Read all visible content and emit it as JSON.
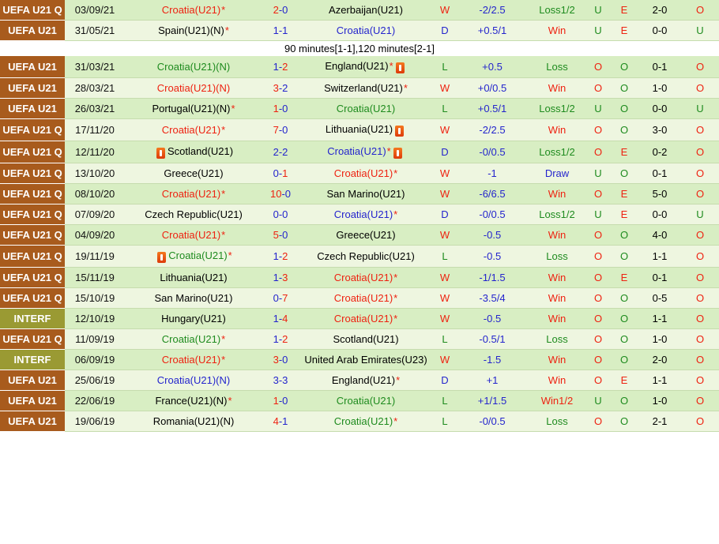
{
  "palette": {
    "win_red": "#ee2211",
    "draw_blue": "#2424cd",
    "loss_green": "#1e8b1e",
    "uefa_cell_brown": "#a85b1d",
    "interf_cell_olive": "#9a9a33",
    "row_green": "#d8eec3",
    "row_light": "#eef6e0",
    "red_card_orange": "#dd3a0a"
  },
  "icons": {
    "red_card": "red-card-with-white-bar"
  },
  "table": {
    "column_semantics": [
      "competition",
      "date",
      "home_team",
      "score",
      "away_team",
      "result_letter",
      "handicap",
      "handicap_result",
      "over_under",
      "even_odd",
      "second_score",
      "second_over_under"
    ],
    "rows": [
      {
        "competition": "UEFA U21 Q",
        "date": "03/09/21",
        "home": {
          "name": "Croatia(U21)",
          "star": true,
          "color": "red"
        },
        "score": {
          "home": "2",
          "away": "0",
          "winner": "home"
        },
        "away": {
          "name": "Azerbaijan(U21)"
        },
        "result": "W",
        "handicap": "-2/2.5",
        "handicap_result": "Loss1/2",
        "over_under": "U",
        "even_odd": "E",
        "second_score": "2-0",
        "second_over_under": "O"
      },
      {
        "competition": "UEFA U21",
        "date": "31/05/21",
        "home": {
          "name": "Spain(U21)(N)",
          "star": true
        },
        "score": {
          "home": "1",
          "away": "1",
          "winner": "none"
        },
        "away": {
          "name": "Croatia(U21)",
          "color": "blue"
        },
        "result": "D",
        "handicap": "+0.5/1",
        "handicap_result": "Win",
        "over_under": "U",
        "even_odd": "E",
        "second_score": "0-0",
        "second_over_under": "U"
      },
      {
        "type": "note",
        "text": "90 minutes[1-1],120 minutes[2-1]"
      },
      {
        "competition": "UEFA U21",
        "date": "31/03/21",
        "home": {
          "name": "Croatia(U21)(N)",
          "color": "green"
        },
        "score": {
          "home": "1",
          "away": "2",
          "winner": "away"
        },
        "away": {
          "name": "England(U21)",
          "star": true,
          "card_after": true
        },
        "result": "L",
        "handicap": "+0.5",
        "handicap_result": "Loss",
        "over_under": "O",
        "even_odd": "O",
        "second_score": "0-1",
        "second_over_under": "O"
      },
      {
        "competition": "UEFA U21",
        "date": "28/03/21",
        "home": {
          "name": "Croatia(U21)(N)",
          "color": "red"
        },
        "score": {
          "home": "3",
          "away": "2",
          "winner": "home"
        },
        "away": {
          "name": "Switzerland(U21)",
          "star": true
        },
        "result": "W",
        "handicap": "+0/0.5",
        "handicap_result": "Win",
        "over_under": "O",
        "even_odd": "O",
        "second_score": "1-0",
        "second_over_under": "O"
      },
      {
        "competition": "UEFA U21",
        "date": "26/03/21",
        "home": {
          "name": "Portugal(U21)(N)",
          "star": true
        },
        "score": {
          "home": "1",
          "away": "0",
          "winner": "home"
        },
        "away": {
          "name": "Croatia(U21)",
          "color": "green"
        },
        "result": "L",
        "handicap": "+0.5/1",
        "handicap_result": "Loss1/2",
        "over_under": "U",
        "even_odd": "O",
        "second_score": "0-0",
        "second_over_under": "U"
      },
      {
        "competition": "UEFA U21 Q",
        "date": "17/11/20",
        "home": {
          "name": "Croatia(U21)",
          "star": true,
          "color": "red"
        },
        "score": {
          "home": "7",
          "away": "0",
          "winner": "home"
        },
        "away": {
          "name": "Lithuania(U21)",
          "card_after": true
        },
        "result": "W",
        "handicap": "-2/2.5",
        "handicap_result": "Win",
        "over_under": "O",
        "even_odd": "O",
        "second_score": "3-0",
        "second_over_under": "O"
      },
      {
        "competition": "UEFA U21 Q",
        "date": "12/11/20",
        "home": {
          "name": "Scotland(U21)",
          "card_before": true
        },
        "score": {
          "home": "2",
          "away": "2",
          "winner": "none"
        },
        "away": {
          "name": "Croatia(U21)",
          "star": true,
          "color": "blue",
          "card_after": true
        },
        "result": "D",
        "handicap": "-0/0.5",
        "handicap_result": "Loss1/2",
        "over_under": "O",
        "even_odd": "E",
        "second_score": "0-2",
        "second_over_under": "O"
      },
      {
        "competition": "UEFA U21 Q",
        "date": "13/10/20",
        "home": {
          "name": "Greece(U21)"
        },
        "score": {
          "home": "0",
          "away": "1",
          "winner": "away"
        },
        "away": {
          "name": "Croatia(U21)",
          "star": true,
          "color": "red"
        },
        "result": "W",
        "handicap": "-1",
        "handicap_result": "Draw",
        "over_under": "U",
        "even_odd": "O",
        "second_score": "0-1",
        "second_over_under": "O"
      },
      {
        "competition": "UEFA U21 Q",
        "date": "08/10/20",
        "home": {
          "name": "Croatia(U21)",
          "star": true,
          "color": "red"
        },
        "score": {
          "home": "10",
          "away": "0",
          "winner": "home"
        },
        "away": {
          "name": "San Marino(U21)"
        },
        "result": "W",
        "handicap": "-6/6.5",
        "handicap_result": "Win",
        "over_under": "O",
        "even_odd": "E",
        "second_score": "5-0",
        "second_over_under": "O"
      },
      {
        "competition": "UEFA U21 Q",
        "date": "07/09/20",
        "home": {
          "name": "Czech Republic(U21)"
        },
        "score": {
          "home": "0",
          "away": "0",
          "winner": "none"
        },
        "away": {
          "name": "Croatia(U21)",
          "star": true,
          "color": "blue"
        },
        "result": "D",
        "handicap": "-0/0.5",
        "handicap_result": "Loss1/2",
        "over_under": "U",
        "even_odd": "E",
        "second_score": "0-0",
        "second_over_under": "U"
      },
      {
        "competition": "UEFA U21 Q",
        "date": "04/09/20",
        "home": {
          "name": "Croatia(U21)",
          "star": true,
          "color": "red"
        },
        "score": {
          "home": "5",
          "away": "0",
          "winner": "home"
        },
        "away": {
          "name": "Greece(U21)"
        },
        "result": "W",
        "handicap": "-0.5",
        "handicap_result": "Win",
        "over_under": "O",
        "even_odd": "O",
        "second_score": "4-0",
        "second_over_under": "O"
      },
      {
        "competition": "UEFA U21 Q",
        "date": "19/11/19",
        "home": {
          "name": "Croatia(U21)",
          "star": true,
          "color": "green",
          "card_before": true
        },
        "score": {
          "home": "1",
          "away": "2",
          "winner": "away"
        },
        "away": {
          "name": "Czech Republic(U21)"
        },
        "result": "L",
        "handicap": "-0.5",
        "handicap_result": "Loss",
        "over_under": "O",
        "even_odd": "O",
        "second_score": "1-1",
        "second_over_under": "O"
      },
      {
        "competition": "UEFA U21 Q",
        "date": "15/11/19",
        "home": {
          "name": "Lithuania(U21)"
        },
        "score": {
          "home": "1",
          "away": "3",
          "winner": "away"
        },
        "away": {
          "name": "Croatia(U21)",
          "star": true,
          "color": "red"
        },
        "result": "W",
        "handicap": "-1/1.5",
        "handicap_result": "Win",
        "over_under": "O",
        "even_odd": "E",
        "second_score": "0-1",
        "second_over_under": "O"
      },
      {
        "competition": "UEFA U21 Q",
        "date": "15/10/19",
        "home": {
          "name": "San Marino(U21)"
        },
        "score": {
          "home": "0",
          "away": "7",
          "winner": "away"
        },
        "away": {
          "name": "Croatia(U21)",
          "star": true,
          "color": "red"
        },
        "result": "W",
        "handicap": "-3.5/4",
        "handicap_result": "Win",
        "over_under": "O",
        "even_odd": "O",
        "second_score": "0-5",
        "second_over_under": "O"
      },
      {
        "competition": "INTERF",
        "date": "12/10/19",
        "home": {
          "name": "Hungary(U21)"
        },
        "score": {
          "home": "1",
          "away": "4",
          "winner": "away"
        },
        "away": {
          "name": "Croatia(U21)",
          "star": true,
          "color": "red"
        },
        "result": "W",
        "handicap": "-0.5",
        "handicap_result": "Win",
        "over_under": "O",
        "even_odd": "O",
        "second_score": "1-1",
        "second_over_under": "O"
      },
      {
        "competition": "UEFA U21 Q",
        "date": "11/09/19",
        "home": {
          "name": "Croatia(U21)",
          "star": true,
          "color": "green"
        },
        "score": {
          "home": "1",
          "away": "2",
          "winner": "away"
        },
        "away": {
          "name": "Scotland(U21)"
        },
        "result": "L",
        "handicap": "-0.5/1",
        "handicap_result": "Loss",
        "over_under": "O",
        "even_odd": "O",
        "second_score": "1-0",
        "second_over_under": "O"
      },
      {
        "competition": "INTERF",
        "date": "06/09/19",
        "home": {
          "name": "Croatia(U21)",
          "star": true,
          "color": "red"
        },
        "score": {
          "home": "3",
          "away": "0",
          "winner": "home"
        },
        "away": {
          "name": "United Arab Emirates(U23)"
        },
        "result": "W",
        "handicap": "-1.5",
        "handicap_result": "Win",
        "over_under": "O",
        "even_odd": "O",
        "second_score": "2-0",
        "second_over_under": "O"
      },
      {
        "competition": "UEFA U21",
        "date": "25/06/19",
        "home": {
          "name": "Croatia(U21)(N)",
          "color": "blue"
        },
        "score": {
          "home": "3",
          "away": "3",
          "winner": "none"
        },
        "away": {
          "name": "England(U21)",
          "star": true
        },
        "result": "D",
        "handicap": "+1",
        "handicap_result": "Win",
        "over_under": "O",
        "even_odd": "E",
        "second_score": "1-1",
        "second_over_under": "O"
      },
      {
        "competition": "UEFA U21",
        "date": "22/06/19",
        "home": {
          "name": "France(U21)(N)",
          "star": true
        },
        "score": {
          "home": "1",
          "away": "0",
          "winner": "home"
        },
        "away": {
          "name": "Croatia(U21)",
          "color": "green"
        },
        "result": "L",
        "handicap": "+1/1.5",
        "handicap_result": "Win1/2",
        "over_under": "U",
        "even_odd": "O",
        "second_score": "1-0",
        "second_over_under": "O"
      },
      {
        "competition": "UEFA U21",
        "date": "19/06/19",
        "home": {
          "name": "Romania(U21)(N)"
        },
        "score": {
          "home": "4",
          "away": "1",
          "winner": "home"
        },
        "away": {
          "name": "Croatia(U21)",
          "star": true,
          "color": "green"
        },
        "result": "L",
        "handicap": "-0/0.5",
        "handicap_result": "Loss",
        "over_under": "O",
        "even_odd": "O",
        "second_score": "2-1",
        "second_over_under": "O"
      }
    ]
  }
}
